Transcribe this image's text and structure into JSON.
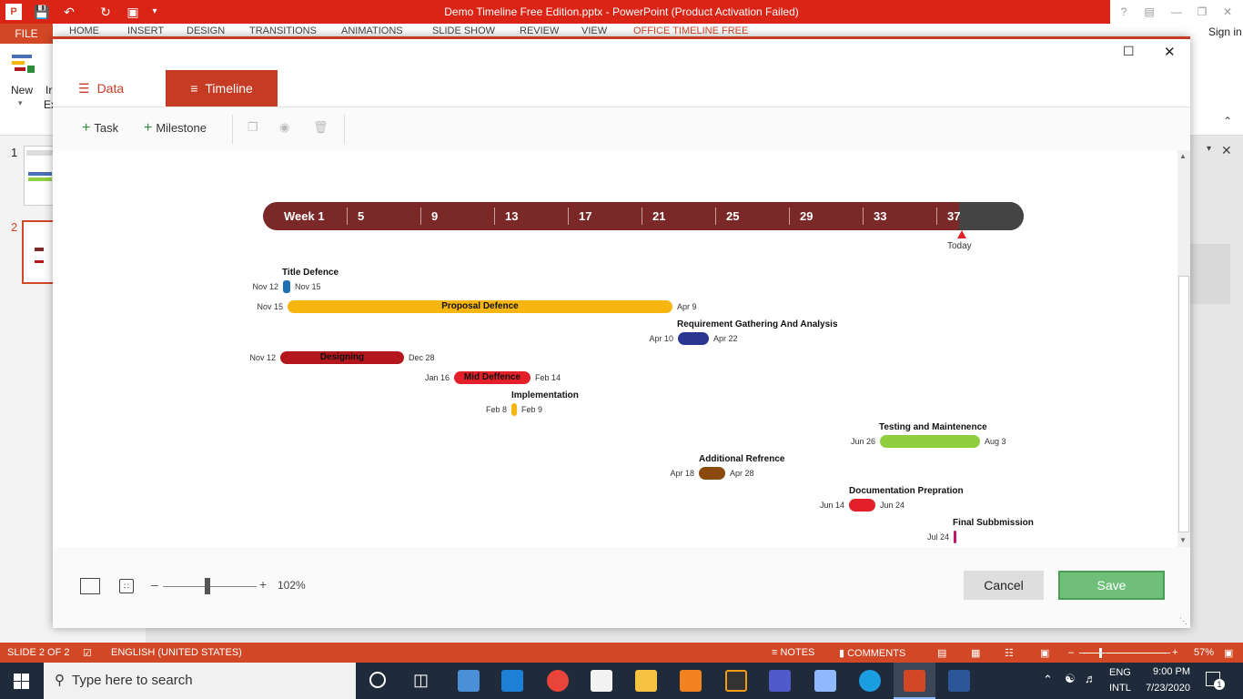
{
  "window": {
    "title": "Demo Timeline Free Edition.pptx - PowerPoint (Product Activation Failed)",
    "help": "?",
    "sign_in": "Sign in"
  },
  "ribbon": {
    "file": "FILE",
    "tabs": [
      "HOME",
      "INSERT",
      "DESIGN",
      "TRANSITIONS",
      "ANIMATIONS",
      "SLIDE SHOW",
      "REVIEW",
      "VIEW",
      "OFFICE TIMELINE FREE"
    ],
    "new_label": "New",
    "ir_label": "Ir",
    "ex_label": "Ex"
  },
  "slides": [
    "1",
    "2"
  ],
  "dialog": {
    "tabs": {
      "data": "Data",
      "timeline": "Timeline"
    },
    "toolbar": {
      "task": "Task",
      "milestone": "Milestone"
    },
    "zoom": "102%",
    "cancel": "Cancel",
    "save": "Save"
  },
  "timeline": {
    "scale": [
      "Week 1",
      "5",
      "9",
      "13",
      "17",
      "21",
      "25",
      "29",
      "33",
      "37"
    ],
    "today": "Today",
    "tasks": [
      {
        "name": "Title Defence",
        "start": "Nov 12",
        "end": "Nov 15",
        "color": "#1f6fb5"
      },
      {
        "name": "Proposal Defence",
        "start": "Nov 15",
        "end": "Apr 9",
        "color": "#f6b60f"
      },
      {
        "name": "Requirement Gathering And Analysis",
        "start": "Apr 10",
        "end": "Apr 22",
        "color": "#2b3592"
      },
      {
        "name": "Designing",
        "start": "Nov 12",
        "end": "Dec 28",
        "color": "#b3171d"
      },
      {
        "name": "Mid Deffence",
        "start": "Jan 16",
        "end": "Feb 14",
        "color": "#e3202a"
      },
      {
        "name": "Implementation",
        "start": "Feb 8",
        "end": "Feb 9",
        "color": "#f6b60f"
      },
      {
        "name": "Testing and Maintenence",
        "start": "Jun 26",
        "end": "Aug 3",
        "color": "#8fce3d"
      },
      {
        "name": "Additional Refrence",
        "start": "Apr 18",
        "end": "Apr 28",
        "color": "#8b4a0c"
      },
      {
        "name": "Documentation Prepration",
        "start": "Jun 14",
        "end": "Jun 24",
        "color": "#e3202a"
      },
      {
        "name": "Final Subbmission",
        "start": "Jul 24",
        "end": "",
        "color": "#c0166c"
      }
    ]
  },
  "statusbar": {
    "slide": "SLIDE 2 OF 2",
    "language": "ENGLISH (UNITED STATES)",
    "notes": "NOTES",
    "comments": "COMMENTS",
    "zoom": "57%"
  },
  "taskbar": {
    "search_placeholder": "Type here to search",
    "lang1": "ENG",
    "lang2": "INTL",
    "time": "9:00 PM",
    "date": "7/23/2020",
    "notifications": "1"
  },
  "colors": {
    "accent": "#c63b23",
    "titlebar": "#d92416",
    "scale": "#7a2828"
  }
}
